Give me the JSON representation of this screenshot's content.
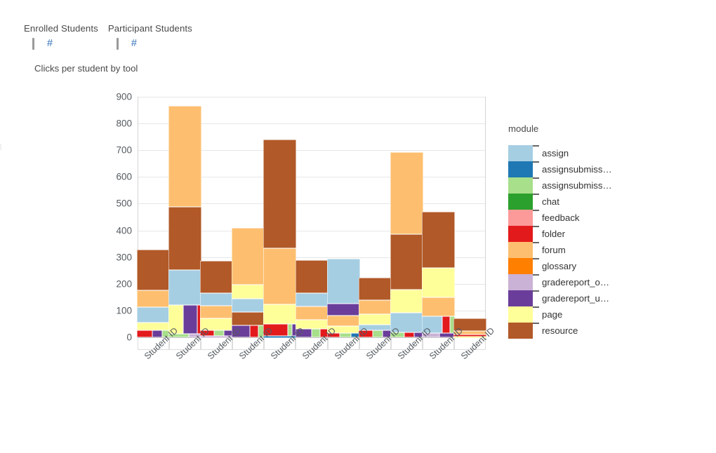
{
  "filters": [
    {
      "title": "Enrolled Students",
      "value": "#",
      "name": "enrolled-students"
    },
    {
      "title": "Participant Students",
      "value": "#",
      "name": "participant-students"
    }
  ],
  "caption": "Clicks per student by tool",
  "legend": {
    "title": "module",
    "items": [
      {
        "label": "assign",
        "color": "#a6cee3"
      },
      {
        "label": "assignsubmiss…",
        "color": "#1f78b4"
      },
      {
        "label": "assignsubmiss…",
        "color": "#a8df8a"
      },
      {
        "label": "chat",
        "color": "#2ca02c"
      },
      {
        "label": "feedback",
        "color": "#fb9a99"
      },
      {
        "label": "folder",
        "color": "#e31a1c"
      },
      {
        "label": "forum",
        "color": "#fdbf6f"
      },
      {
        "label": "glossary",
        "color": "#ff7f00"
      },
      {
        "label": "gradereport_o…",
        "color": "#cab2d6"
      },
      {
        "label": "gradereport_u…",
        "color": "#6a3d9a"
      },
      {
        "label": "page",
        "color": "#ffff99"
      },
      {
        "label": "resource",
        "color": "#b15928"
      }
    ]
  },
  "chart_data": {
    "type": "bar",
    "title": "Clicks per student by tool",
    "xlabel": "",
    "ylabel": "",
    "ylim": [
      0,
      900
    ],
    "ytick_step": 100,
    "yticks": [
      0,
      100,
      200,
      300,
      400,
      500,
      600,
      700,
      800,
      900
    ],
    "grid": true,
    "legend_position": "right",
    "categories": [
      "Student ID",
      "Student ID",
      "Student ID",
      "Student ID",
      "Student ID",
      "Student ID",
      "Student ID",
      "Student ID",
      "Student ID",
      "Student ID",
      "Student ID"
    ],
    "totals": [
      328,
      867,
      287,
      409,
      740,
      289,
      238,
      223,
      694,
      470,
      70
    ],
    "series": [
      {
        "name": "assign",
        "color": "#a6cee3",
        "values": [
          57,
          131,
          47,
          50,
          0,
          50,
          170,
          22,
          72,
          38,
          0
        ]
      },
      {
        "name": "assignsubmiss…",
        "color": "#1f78b4",
        "values": [
          0,
          0,
          0,
          0,
          4,
          0,
          4,
          0,
          0,
          0,
          0
        ]
      },
      {
        "name": "assignsubmiss…",
        "color": "#a8df8a",
        "values": [
          6,
          8,
          6,
          9,
          6,
          8,
          5,
          7,
          8,
          9,
          0
        ]
      },
      {
        "name": "chat",
        "color": "#2ca02c",
        "values": [
          0,
          0,
          0,
          0,
          0,
          0,
          0,
          0,
          0,
          0,
          0
        ]
      },
      {
        "name": "feedback",
        "color": "#fb9a99",
        "values": [
          0,
          0,
          0,
          0,
          0,
          0,
          0,
          0,
          0,
          0,
          0
        ]
      },
      {
        "name": "folder",
        "color": "#e31a1c",
        "values": [
          12,
          14,
          9,
          11,
          33,
          8,
          6,
          11,
          6,
          15,
          6
        ]
      },
      {
        "name": "forum",
        "color": "#fdbf6f",
        "values": [
          65,
          379,
          46,
          212,
          210,
          50,
          38,
          52,
          309,
          70,
          12
        ]
      },
      {
        "name": "glossary",
        "color": "#ff7f00",
        "values": [
          0,
          0,
          0,
          0,
          0,
          0,
          0,
          0,
          0,
          0,
          0
        ]
      },
      {
        "name": "gradereport_o…",
        "color": "#cab2d6",
        "values": [
          0,
          5,
          5,
          0,
          0,
          0,
          0,
          0,
          0,
          9,
          0
        ]
      },
      {
        "name": "gradereport_u…",
        "color": "#6a3d9a",
        "values": [
          8,
          45,
          6,
          25,
          6,
          16,
          44,
          7,
          5,
          8,
          0
        ]
      },
      {
        "name": "page",
        "color": "#ffff99",
        "values": [
          29,
          49,
          45,
          52,
          75,
          33,
          28,
          39,
          88,
          110,
          5
        ]
      },
      {
        "name": "resource",
        "color": "#b15928",
        "values": [
          151,
          236,
          123,
          50,
          406,
          124,
          0,
          85,
          206,
          211,
          47
        ]
      }
    ]
  },
  "xaxis": {
    "tick_label": "Student ID",
    "tick_count": 11
  }
}
